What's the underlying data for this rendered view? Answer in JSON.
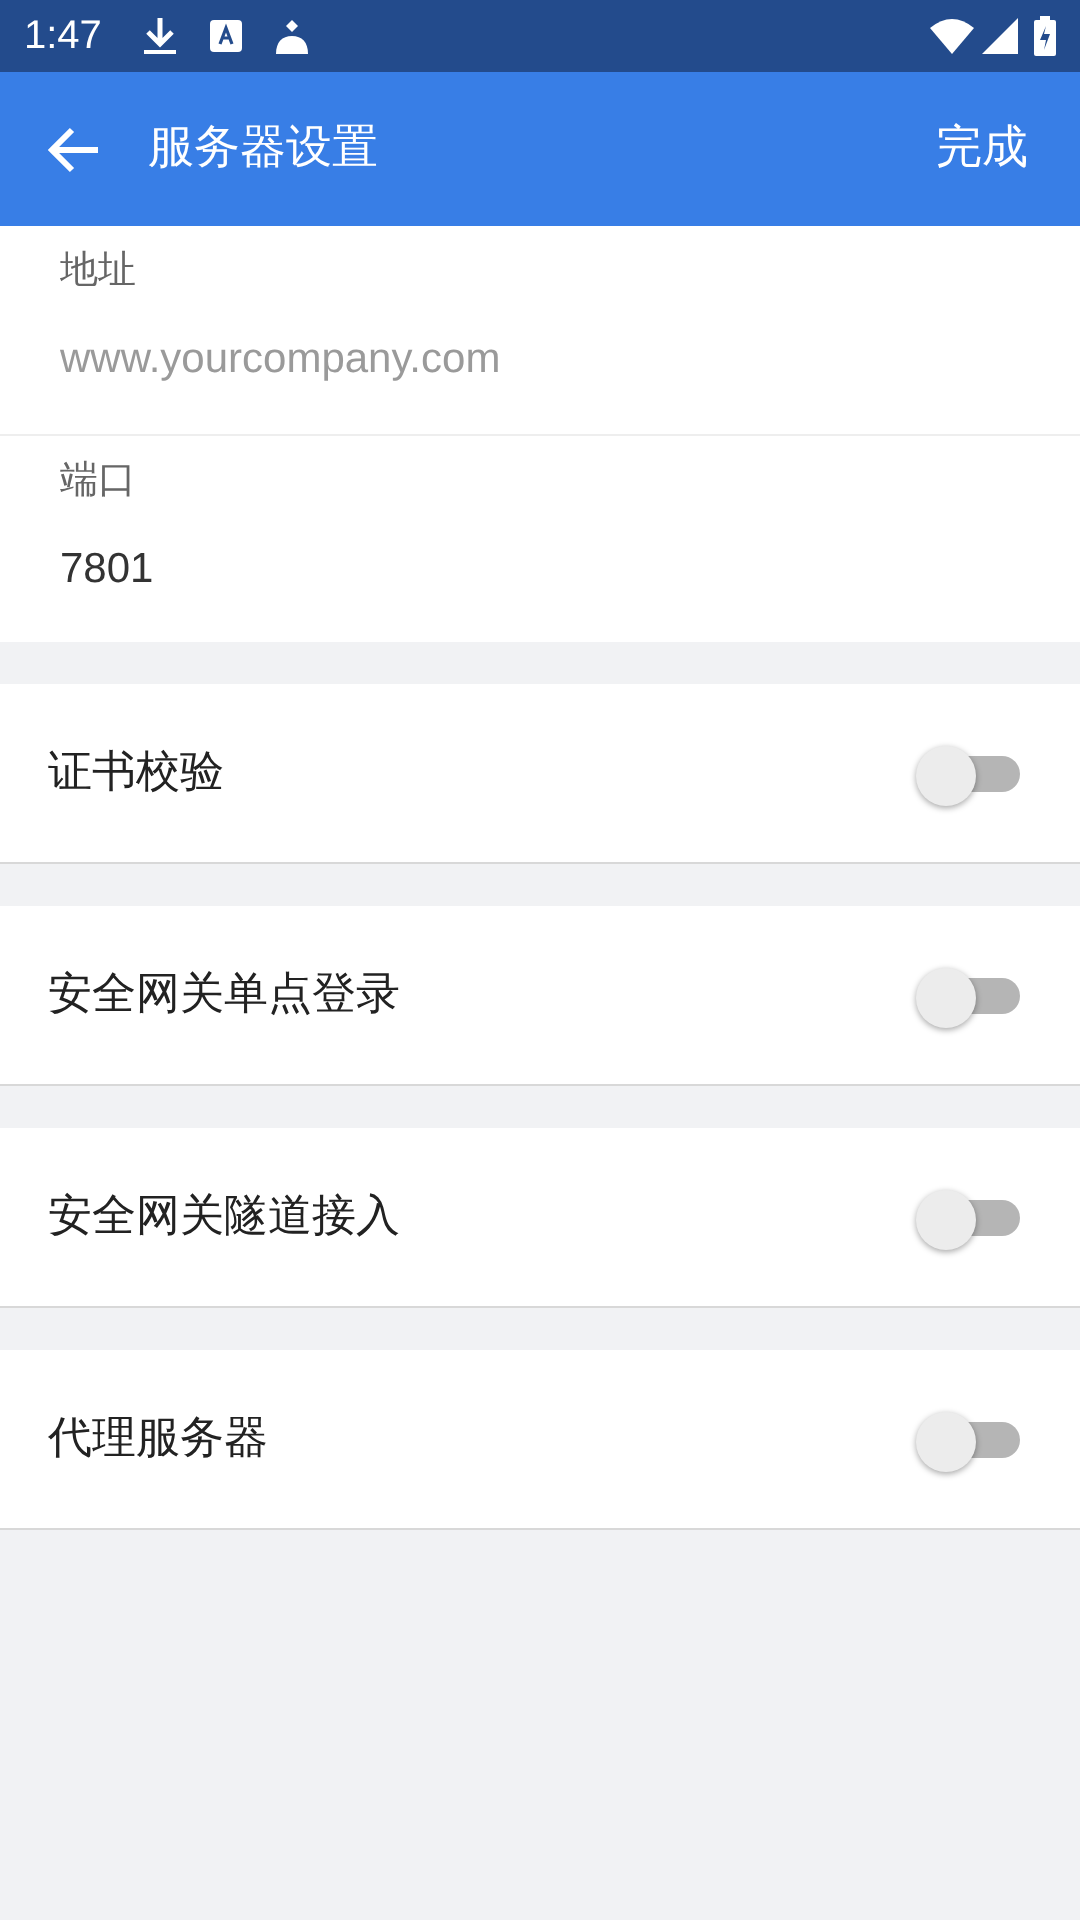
{
  "status_bar": {
    "time": "1:47"
  },
  "app_bar": {
    "title": "服务器设置",
    "action": "完成"
  },
  "fields": [
    {
      "label": "地址",
      "placeholder": "www.yourcompany.com"
    },
    {
      "label": "端口",
      "value": "7801"
    }
  ],
  "toggles": [
    {
      "label": "证书校验",
      "on": false
    },
    {
      "label": "安全网关单点登录",
      "on": false
    },
    {
      "label": "安全网关隧道接入",
      "on": false
    },
    {
      "label": "代理服务器",
      "on": false
    }
  ]
}
